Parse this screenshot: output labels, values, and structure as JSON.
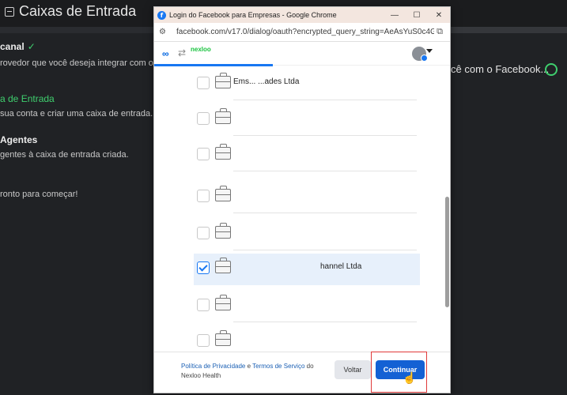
{
  "background_app": {
    "title": "Caixas de Entrada",
    "steps": [
      {
        "title": "canal",
        "desc": "rovedor que você deseja integrar com o",
        "done": true
      },
      {
        "title": "a de Entrada",
        "desc": "sua conta e criar uma caixa de entrada.",
        "active": true
      },
      {
        "title": "Agentes",
        "desc": "gentes à caixa de entrada criada."
      },
      {
        "title": "",
        "desc": "ronto para começar!"
      }
    ],
    "right_text": "cê com o Facebook..."
  },
  "window": {
    "title": "Login do Facebook para Empresas - Google Chrome",
    "minimize": "—",
    "maximize": "☐",
    "close": "✕"
  },
  "urlbar": {
    "url": "facebook.com/v17.0/dialog/oauth?encrypted_query_string=AeAsYuS0c4GW..."
  },
  "dialog": {
    "meta_logo": "∞",
    "nexloo_logo": "nexloo",
    "rows": [
      {
        "label": "Ems... ...ades Ltda",
        "checked": false
      },
      {
        "label": "",
        "checked": false
      },
      {
        "label": "",
        "checked": false
      },
      {
        "label": "",
        "checked": false
      },
      {
        "label": "",
        "checked": false
      },
      {
        "label": "hannel Ltda",
        "checked": true
      },
      {
        "label": "",
        "checked": false
      },
      {
        "label": "",
        "checked": false
      }
    ],
    "footer": {
      "privacy": "Política de Privacidade",
      "and": "e",
      "terms": "Termos de Serviço",
      "of": "do",
      "company": "Nexloo Health"
    },
    "back_label": "Voltar",
    "continue_label": "Continuar"
  }
}
